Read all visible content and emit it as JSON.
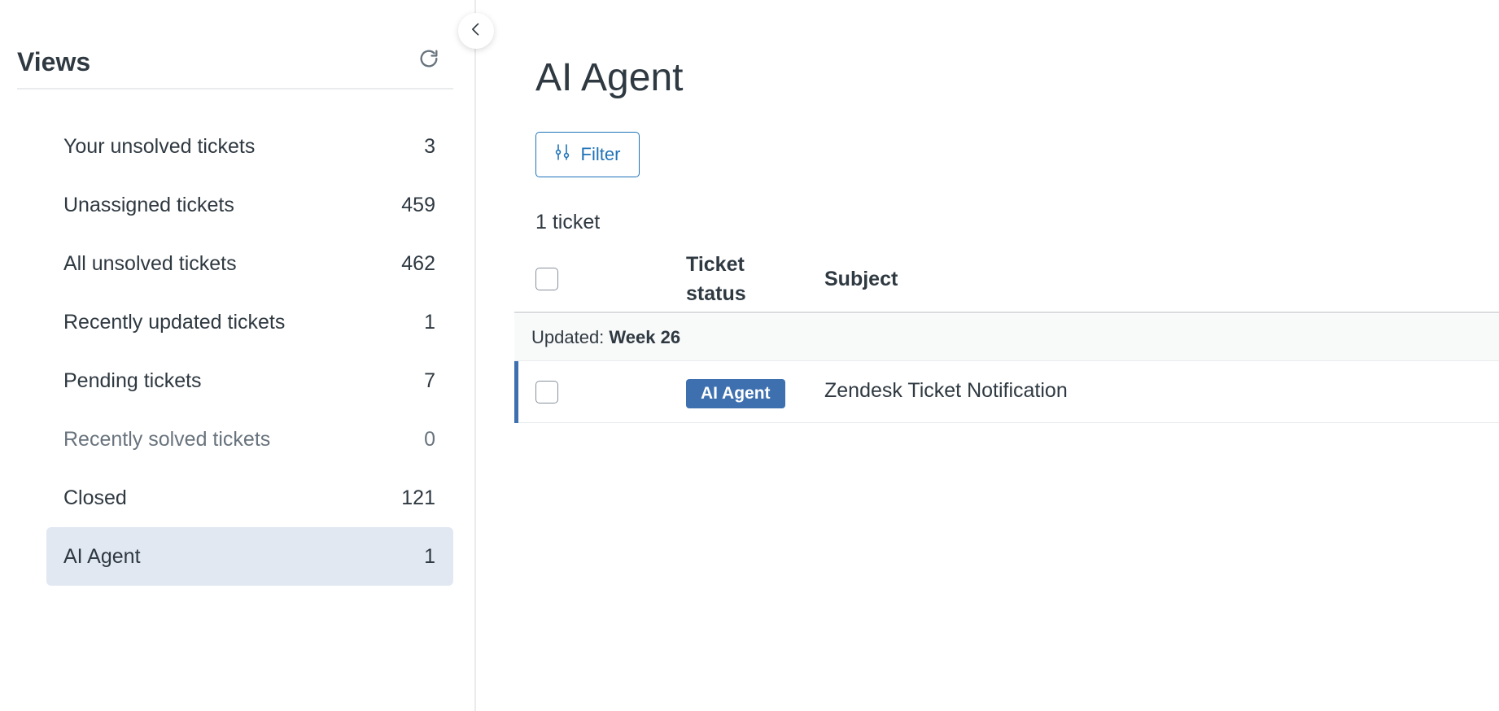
{
  "sidebar": {
    "title": "Views",
    "refresh_icon": "refresh-icon",
    "items": [
      {
        "label": "Your unsolved tickets",
        "count": "3"
      },
      {
        "label": "Unassigned tickets",
        "count": "459"
      },
      {
        "label": "All unsolved tickets",
        "count": "462"
      },
      {
        "label": "Recently updated tickets",
        "count": "1"
      },
      {
        "label": "Pending tickets",
        "count": "7"
      },
      {
        "label": "Recently solved tickets",
        "count": "0"
      },
      {
        "label": "Closed",
        "count": "121"
      },
      {
        "label": "AI Agent",
        "count": "1"
      }
    ],
    "active_item": "AI Agent"
  },
  "main": {
    "title": "AI Agent",
    "filter_label": "Filter",
    "ticket_count": "1 ticket",
    "columns": {
      "status_line1": "Ticket",
      "status_line2": "status",
      "subject": "Subject"
    },
    "group": {
      "prefix": "Updated: ",
      "value": "Week 26"
    },
    "tickets": [
      {
        "status": "AI Agent",
        "subject": "Zendesk Ticket Notification"
      }
    ]
  },
  "colors": {
    "accent": "#1f73b7",
    "badge": "#3e70b0",
    "active_bg": "#e2e8f2",
    "text": "#2f3941",
    "muted_text": "#68737d"
  }
}
